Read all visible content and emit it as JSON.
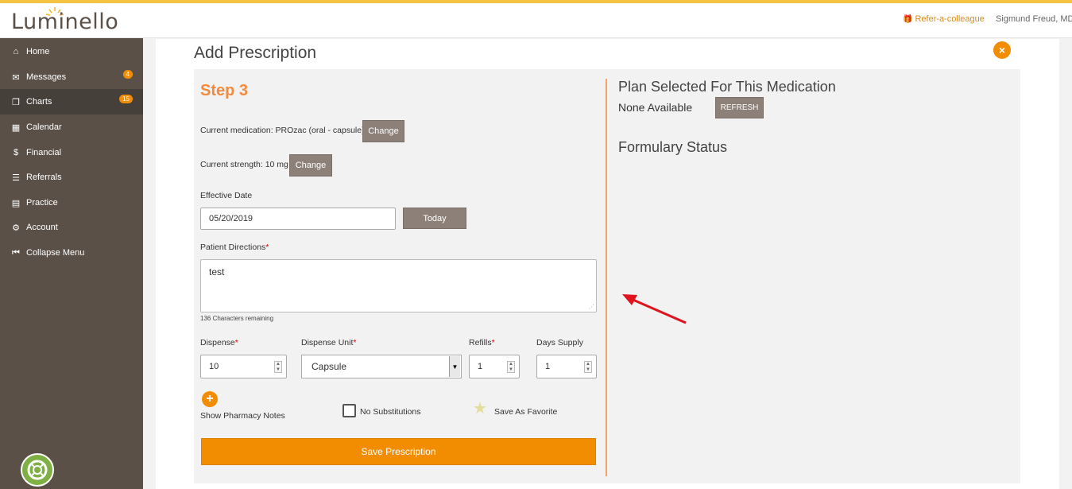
{
  "header": {
    "logo": "Luminello",
    "refer_label": "Refer-a-colleague",
    "user_name": "Sigmund Freud, MD"
  },
  "sidebar": {
    "items": [
      {
        "label": "Home",
        "icon": "home-icon"
      },
      {
        "label": "Messages",
        "icon": "envelope-icon",
        "badge": "4"
      },
      {
        "label": "Charts",
        "icon": "copy-icon",
        "badge": "15"
      },
      {
        "label": "Calendar",
        "icon": "calendar-icon"
      },
      {
        "label": "Financial",
        "icon": "dollar-icon"
      },
      {
        "label": "Referrals",
        "icon": "list-icon"
      },
      {
        "label": "Practice",
        "icon": "id-card-icon"
      },
      {
        "label": "Account",
        "icon": "gear-icon"
      },
      {
        "label": "Collapse Menu",
        "icon": "collapse-icon"
      }
    ]
  },
  "main": {
    "title": "Add Prescription",
    "step": "Step 3",
    "current_medication": "Current medication: PROzac (oral - capsule)",
    "current_strength": "Current strength: 10 mg",
    "change_label": "Change",
    "effective_date_label": "Effective Date",
    "effective_date_value": "05/20/2019",
    "today_label": "Today",
    "patient_directions_label": "Patient Directions",
    "patient_directions_value": "test",
    "chars_remaining": "136 Characters remaining",
    "dispense_label": "Dispense",
    "dispense_value": "10",
    "dispense_unit_label": "Dispense Unit",
    "dispense_unit_value": "Capsule",
    "refills_label": "Refills",
    "refills_value": "1",
    "days_supply_label": "Days Supply",
    "days_supply_value": "1",
    "pharmacy_notes_label": "Show Pharmacy Notes",
    "no_substitutions_label": "No Substitutions",
    "save_favorite_label": "Save As Favorite",
    "save_button": "Save Prescription",
    "plan_title": "Plan Selected For This Medication",
    "plan_value": "None Available",
    "refresh_label": "REFRESH",
    "formulary_title": "Formulary Status"
  },
  "colors": {
    "accent": "#f28c00",
    "sidebar": "#5a5048",
    "step": "#f58a3c",
    "annotation_arrow": "#e0141e"
  }
}
